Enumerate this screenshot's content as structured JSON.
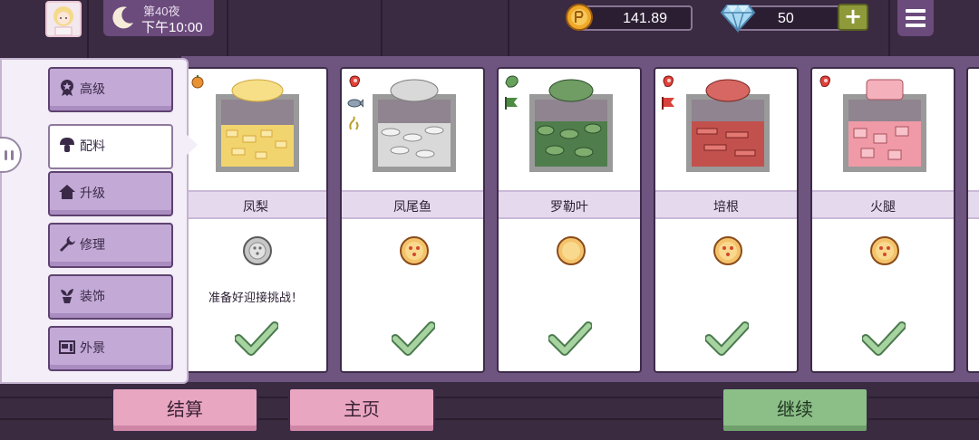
{
  "hud": {
    "night": "第40夜",
    "time": "下午10:00",
    "coins": "141.89",
    "gems": "50",
    "plus_label": "+"
  },
  "sidebar": {
    "items": [
      {
        "label": "高级",
        "icon": "medal-icon",
        "active": false
      },
      {
        "label": "配料",
        "icon": "mushroom-icon",
        "active": true
      },
      {
        "label": "升级",
        "icon": "house-icon",
        "active": false
      },
      {
        "label": "修理",
        "icon": "wrench-icon",
        "active": false
      },
      {
        "label": "装饰",
        "icon": "plant-icon",
        "active": false
      },
      {
        "label": "外景",
        "icon": "storefront-icon",
        "active": false
      }
    ]
  },
  "ingredients": [
    {
      "name": "凤梨",
      "message": "准备好迎接挑战！",
      "medal": "silver",
      "tags": [
        "orange-fruit-tag"
      ]
    },
    {
      "name": "凤尾鱼",
      "message": "",
      "medal": "gold",
      "tags": [
        "meat-tag",
        "fish-tag",
        "seaweed-tag"
      ]
    },
    {
      "name": "罗勒叶",
      "message": "",
      "medal": "gold",
      "tags": [
        "leaf-tag",
        "green-flag-tag"
      ]
    },
    {
      "name": "培根",
      "message": "",
      "medal": "gold",
      "tags": [
        "meat-tag",
        "red-flag-tag"
      ]
    },
    {
      "name": "火腿",
      "message": "",
      "medal": "gold",
      "tags": [
        "meat-tag"
      ]
    }
  ],
  "buttons": {
    "settle": "结算",
    "home": "主页",
    "continue": "继续"
  },
  "colors": {
    "panel": "#6e5580",
    "nav_button": "#c3a9d6",
    "pink_button": "#e9a6c1",
    "green_button": "#8cbf88",
    "check": "#8cbf88"
  }
}
